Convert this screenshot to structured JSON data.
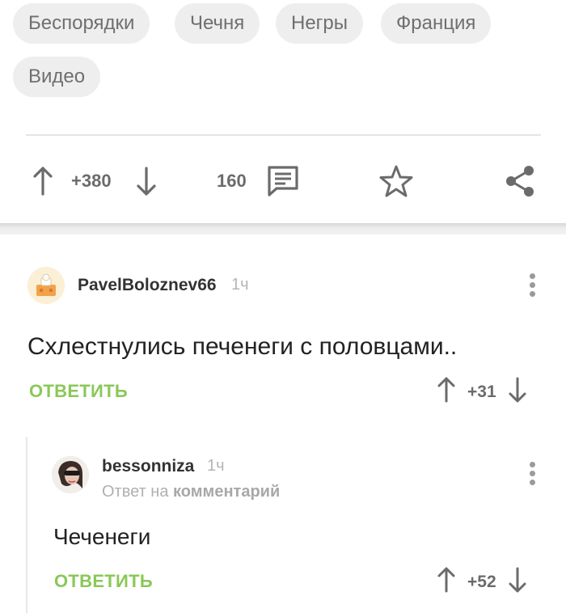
{
  "tags": [
    "Беспорядки",
    "Чечня",
    "Негры",
    "Франция",
    "Видео"
  ],
  "post_actions": {
    "rating": "+380",
    "comments_count": "160"
  },
  "comments": [
    {
      "author": "PavelBoloznev66",
      "time": "1ч",
      "text": "Схлестнулись печенеги с половцами..",
      "reply_label": "ОТВЕТИТЬ",
      "rating": "+31"
    },
    {
      "author": "bessonniza",
      "time": "1ч",
      "reply_to_prefix": "Ответ на",
      "reply_to_target": "комментарий",
      "text": "Чеченеги",
      "reply_label": "ОТВЕТИТЬ",
      "rating": "+52"
    }
  ],
  "icons": {
    "upvote": "arrow-up-icon",
    "downvote": "arrow-down-icon",
    "comments": "comment-icon",
    "save": "star-icon",
    "share": "share-icon",
    "menu": "more-vertical-icon"
  },
  "colors": {
    "accent_green": "#8ac858",
    "tag_bg": "#eeeeee",
    "icon_gray": "#6b6b6b"
  }
}
